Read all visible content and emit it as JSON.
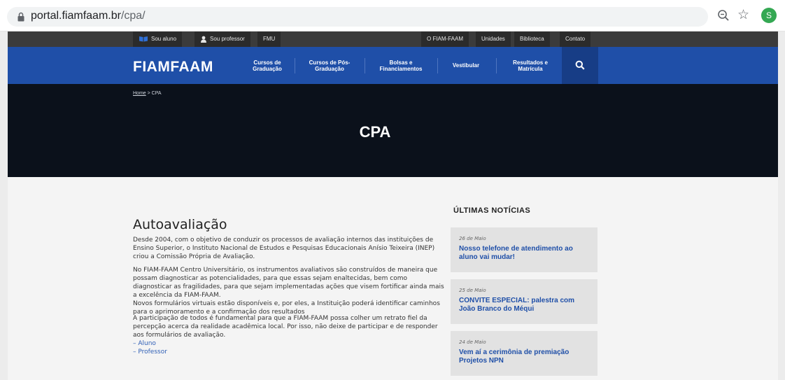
{
  "browser": {
    "url_host": "portal.fiamfaam.br",
    "url_path": "/cpa/",
    "avatar_letter": "S"
  },
  "utility": {
    "left_links": [
      "Sou aluno",
      "Sou professor",
      "FMU"
    ],
    "right_links": [
      "O FIAM-FAAM",
      "Unidades",
      "Biblioteca",
      "Contato"
    ]
  },
  "nav": {
    "logo": "FIAMFAAM",
    "items": [
      {
        "line1": "Cursos de",
        "line2": "Graduação"
      },
      {
        "line1": "Cursos de Pós-",
        "line2": "Graduação"
      },
      {
        "line1": "Bolsas e",
        "line2": "Financiamentos"
      },
      {
        "line1": "Vestibular",
        "line2": ""
      },
      {
        "line1": "Resultados e",
        "line2": "Matrícula"
      }
    ]
  },
  "hero": {
    "breadcrumb_home": "Home",
    "breadcrumb_sep": " > ",
    "breadcrumb_current": "CPA",
    "title": "CPA"
  },
  "main": {
    "title": "Autoavaliação",
    "p1": "Desde 2004, com o objetivo de conduzir os processos de avaliação internos das instituições de Ensino Superior, o Instituto Nacional de Estudos e Pesquisas Educacionais Anísio Teixeira (INEP) criou a Comissão Própria de Avaliação.",
    "p2a": "No FIAM-FAAM Centro Universitário, os instrumentos avaliativos são construídos de maneira que possam diagnosticar as potencialidades, para que essas sejam enaltecidas, bem como diagnosticar as fragilidades, para que sejam implementadas ações que visem fortificar ainda mais a excelência da FIAM-FAAM.",
    "p2b": "Novos formulários virtuais estão disponíveis e, por eles, a Instituição poderá identificar caminhos para o aprimoramento e a confirmação dos resultados",
    "p3": "A participação de todos é fundamental para que a FIAM-FAAM possa colher um retrato fiel da percepção acerca da realidade acadêmica local. Por isso, não deixe de participar e de responder aos formulários de avaliação.",
    "link_aluno": "– Aluno",
    "link_professor": "– Professor"
  },
  "news": {
    "heading": "ÚLTIMAS NOTÍCIAS",
    "items": [
      {
        "date": "26 de Maio",
        "title": "Nosso telefone de atendimento ao aluno vai mudar!"
      },
      {
        "date": "25 de Maio",
        "title": "CONVITE ESPECIAL: palestra com João Branco do Méqui"
      },
      {
        "date": "24 de Maio",
        "title": "Vem aí a cerimônia de premiação Projetos NPN"
      }
    ]
  },
  "colors": {
    "brand_blue": "#1f4fa8",
    "hero_bg": "#0b111b",
    "link_blue": "#2f5fb6"
  }
}
